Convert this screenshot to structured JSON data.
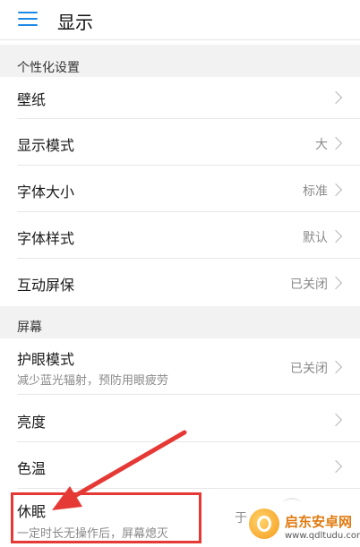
{
  "header": {
    "title": "显示",
    "menu_icon": "hamburger-menu-icon",
    "accent": "#1e88e5"
  },
  "sections": {
    "personalization": "个性化设置",
    "screen": "屏幕"
  },
  "rows": {
    "wallpaper": {
      "label": "壁纸"
    },
    "display_mode": {
      "label": "显示模式",
      "value": "大"
    },
    "font_size": {
      "label": "字体大小",
      "value": "标准"
    },
    "font_style": {
      "label": "字体样式",
      "value": "默认"
    },
    "screensaver": {
      "label": "互动屏保",
      "value": "已关闭"
    },
    "eye_comfort": {
      "label": "护眼模式",
      "subtitle": "减少蓝光辐射，预防用眼疲劳",
      "value": "已关闭"
    },
    "brightness": {
      "label": "亮度"
    },
    "color_temp": {
      "label": "色温"
    },
    "sleep": {
      "label": "休眠",
      "subtitle": "一定时长无操作后，屏幕熄灭",
      "value_partial": "于"
    }
  },
  "annotation": {
    "color": "#e53935"
  },
  "watermark": {
    "brand": "启东安卓网",
    "url": "www.qdltudu.com"
  }
}
